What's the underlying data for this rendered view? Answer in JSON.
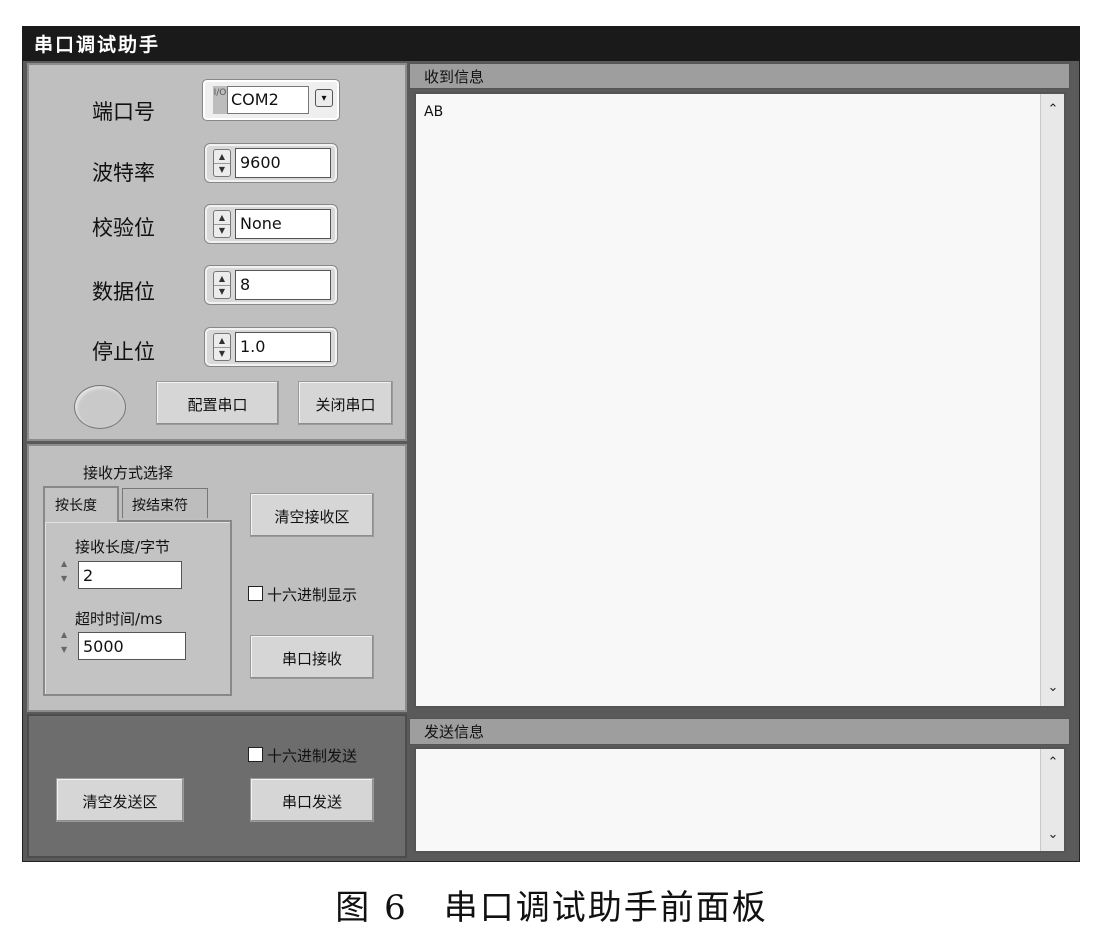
{
  "window": {
    "title": "串口调试助手"
  },
  "config": {
    "port": {
      "label": "端口号",
      "value": "COM2",
      "io_prefix": "I/O"
    },
    "baud": {
      "label": "波特率",
      "value": "9600"
    },
    "parity": {
      "label": "校验位",
      "value": "None"
    },
    "databits": {
      "label": "数据位",
      "value": "8"
    },
    "stopbits": {
      "label": "停止位",
      "value": "1.0"
    },
    "configure_button": "配置串口",
    "close_button": "关闭串口"
  },
  "receive": {
    "mode_label": "接收方式选择",
    "tabs": [
      {
        "label": "按长度"
      },
      {
        "label": "按结束符"
      }
    ],
    "length_label": "接收长度/字节",
    "length_value": "2",
    "timeout_label": "超时时间/ms",
    "timeout_value": "5000",
    "clear_button": "清空接收区",
    "hex_display_label": "十六进制显示",
    "receive_button": "串口接收"
  },
  "send": {
    "hex_send_label": "十六进制发送",
    "clear_button": "清空发送区",
    "send_button": "串口发送"
  },
  "received_info": {
    "header": "收到信息",
    "content": "AB"
  },
  "sent_info": {
    "header": "发送信息",
    "content": ""
  },
  "caption": "图 6　串口调试助手前面板"
}
